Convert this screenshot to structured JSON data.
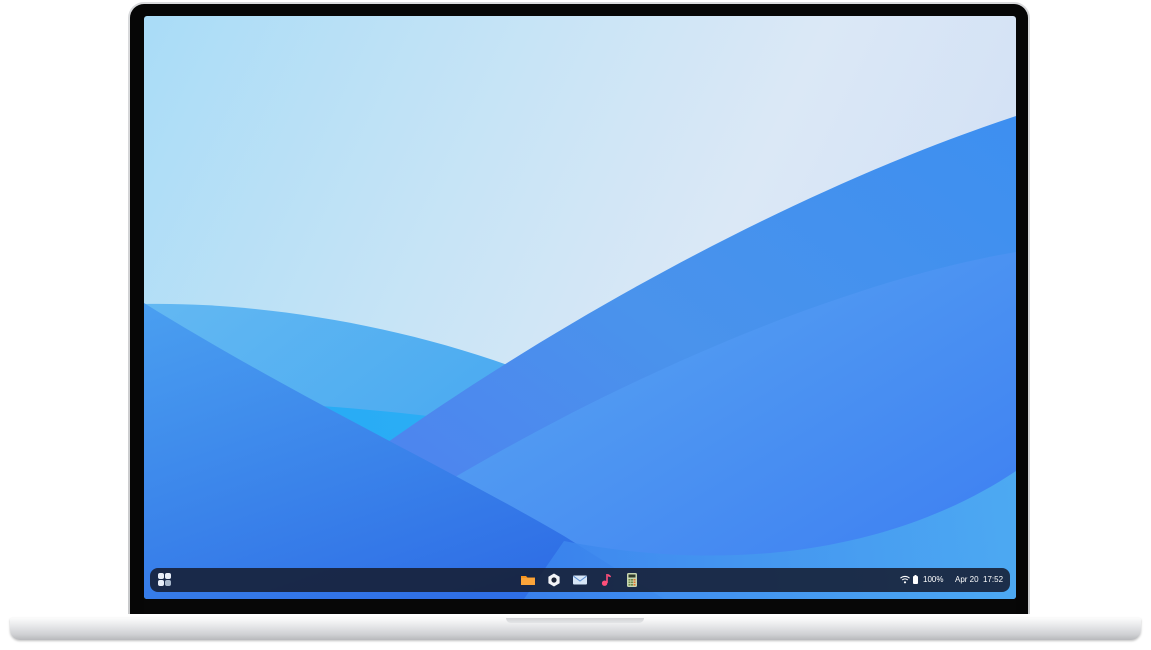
{
  "taskbar": {
    "launcher_icon": "app-launcher-grid-icon",
    "apps": [
      {
        "name": "files",
        "icon": "folder-icon",
        "color": "#f7931e"
      },
      {
        "name": "settings",
        "icon": "gear-icon",
        "color": "#ffffff"
      },
      {
        "name": "mail",
        "icon": "mail-icon",
        "color": "#d7e6f7"
      },
      {
        "name": "music",
        "icon": "music-note-icon",
        "color": "#ff4f7a"
      },
      {
        "name": "calculator",
        "icon": "calculator-icon",
        "color": "#8bc34a"
      }
    ],
    "tray": {
      "wifi_icon": "wifi-icon",
      "battery_icon": "battery-icon",
      "battery": "100%",
      "date": "Apr 20",
      "time": "17:52"
    }
  },
  "colors": {
    "taskbar_bg": "#161e32",
    "wallpaper_blue": "#3f8af0",
    "wallpaper_light": "#c7e4f6"
  }
}
